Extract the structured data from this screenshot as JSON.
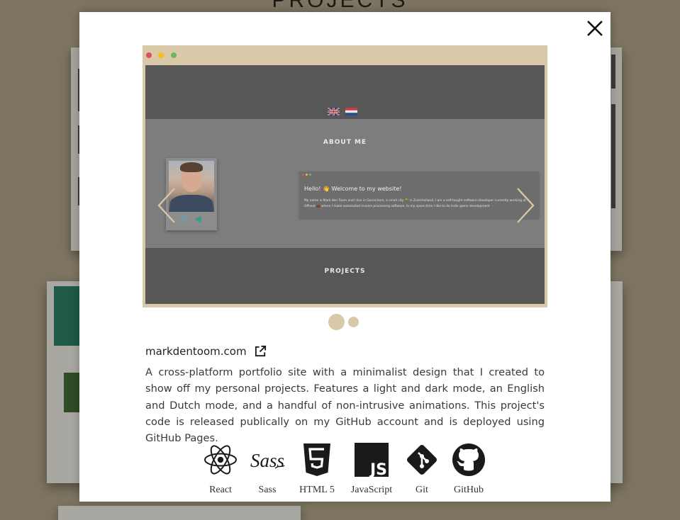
{
  "page": {
    "heading": "PROJECTS"
  },
  "colors": {
    "overlay": "#7d7461",
    "accent": "#d9c9a8",
    "modal": "#ffffff"
  },
  "modal": {
    "close_icon": "close-icon",
    "carousel": {
      "slide_count": 2,
      "active_slide": 1,
      "slide": {
        "about_title": "ABOUT ME",
        "projects_title": "PROJECTS",
        "welcome_heading": "Hello! 👋 Welcome to my website!",
        "welcome_text": "My name is Mark den Toom and I live in Gorinchem, a small city 🌳 in Zuid-Holland. I am a self-taught software developer currently working at OPhest 💼 where I make automated invoice processing software. In my spare time I like to do indie game development 🎮"
      }
    },
    "project": {
      "title": "markdentoom.com",
      "link_icon": "external-link-icon",
      "description": "A cross-platform portfolio site with a minimalist design that I created to show off my personal projects. Features a light and dark mode, an English and Dutch mode, and a handful of non-intrusive animations. This project's code is released publically on my GitHub account and is deployed using GitHub Pages."
    },
    "technologies": [
      {
        "label": "React",
        "icon": "react-icon"
      },
      {
        "label": "Sass",
        "icon": "sass-icon"
      },
      {
        "label": "HTML  5",
        "icon": "html5-icon"
      },
      {
        "label": "JavaScript",
        "icon": "javascript-icon"
      },
      {
        "label": "Git",
        "icon": "git-icon"
      },
      {
        "label": "GitHub",
        "icon": "github-icon"
      }
    ]
  }
}
